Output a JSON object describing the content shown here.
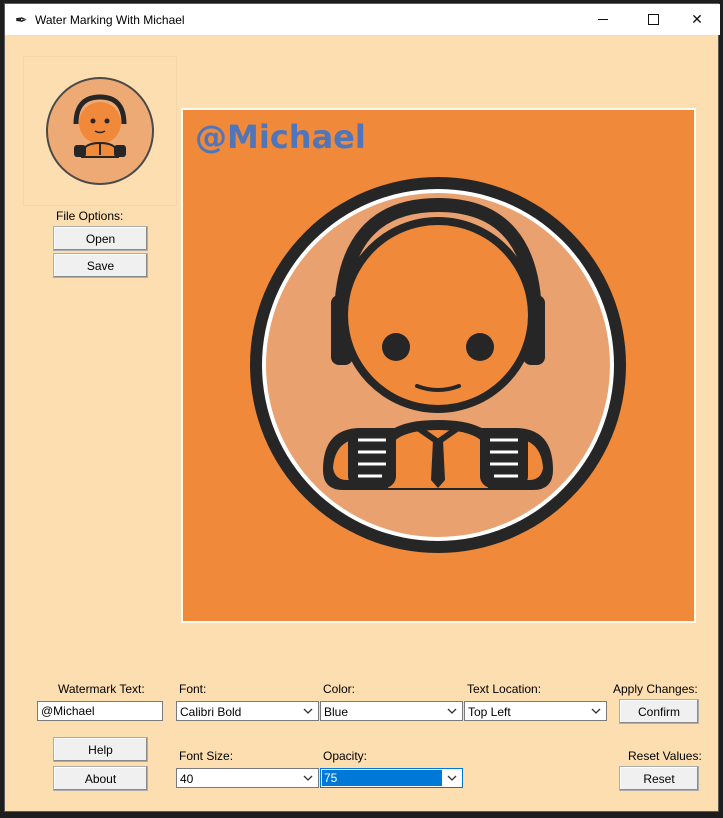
{
  "window": {
    "title": "Water Marking With Michael"
  },
  "sidebar": {
    "file_options_label": "File Options:",
    "open_label": "Open",
    "save_label": "Save",
    "help_label": "Help",
    "about_label": "About"
  },
  "preview": {
    "watermark_text": "@Michael"
  },
  "controls": {
    "watermark_text_label": "Watermark Text:",
    "watermark_text_value": "@Michael",
    "font_label": "Font:",
    "font_value": "Calibri Bold",
    "color_label": "Color:",
    "color_value": "Blue",
    "text_location_label": "Text Location:",
    "text_location_value": "Top Left",
    "apply_changes_label": "Apply Changes:",
    "confirm_label": "Confirm",
    "font_size_label": "Font Size:",
    "font_size_value": "40",
    "opacity_label": "Opacity:",
    "opacity_value": "75",
    "reset_values_label": "Reset Values:",
    "reset_label": "Reset"
  },
  "colors": {
    "window_bg": "#fcdeb0",
    "image_bg": "#f1893a",
    "watermark": "#3d74c9",
    "selection": "#0078d7"
  }
}
